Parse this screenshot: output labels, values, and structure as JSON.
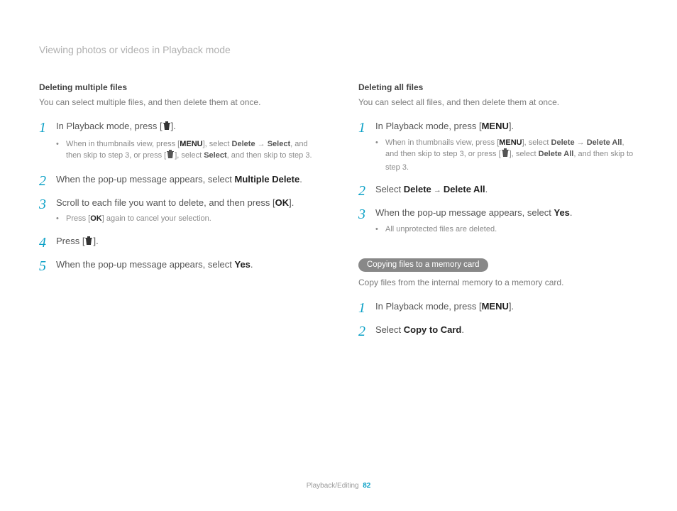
{
  "header": "Viewing photos or videos in Playback mode",
  "left": {
    "title": "Deleting multiple files",
    "intro": "You can select multiple files, and then delete them at once.",
    "s1": "In Playback mode, press [",
    "s1_end": "].",
    "s1_sub_a": "When in thumbnails view, press [",
    "s1_sub_b": "], select ",
    "s1_sub_delete": "Delete",
    "s1_sub_arrow": " → ",
    "s1_sub_select": "Select",
    "s1_sub_c": ", and then skip to step 3, or press [",
    "s1_sub_d": "], select ",
    "s1_sub_select2": "Select",
    "s1_sub_e": ", and then skip to step 3.",
    "s2_a": "When the pop-up message appears, select ",
    "s2_b": "Multiple Delete",
    "s2_c": ".",
    "s3_a": "Scroll to each file you want to delete, and then press [",
    "s3_b": "].",
    "s3_sub_a": "Press [",
    "s3_sub_b": "] again to cancel your selection.",
    "s4_a": "Press [",
    "s4_b": "].",
    "s5_a": "When the pop-up message appears, select ",
    "s5_b": "Yes",
    "s5_c": "."
  },
  "right": {
    "title": "Deleting all files",
    "intro": "You can select all files, and then delete them at once.",
    "s1": "In Playback mode, press [",
    "s1_end": "].",
    "s1_sub_a": "When in thumbnails view, press [",
    "s1_sub_b": "], select ",
    "s1_sub_delete": "Delete",
    "s1_sub_arrow": " → ",
    "s1_sub_deleteall": "Delete All",
    "s1_sub_c": ", and then skip to step 3, or press [",
    "s1_sub_d": "], select ",
    "s1_sub_deleteall2": "Delete All",
    "s1_sub_e": ", and then skip to step 3.",
    "s2_a": "Select ",
    "s2_b": "Delete",
    "s2_arrow": " → ",
    "s2_c": "Delete All",
    "s2_d": ".",
    "s3_a": "When the pop-up message appears, select ",
    "s3_b": "Yes",
    "s3_c": ".",
    "s3_sub": "All unprotected files are deleted.",
    "pill": "Copying files to a memory card",
    "copy_intro": "Copy files from the internal memory to a memory card.",
    "c1": "In Playback mode, press [",
    "c1_end": "].",
    "c2_a": "Select ",
    "c2_b": "Copy to Card",
    "c2_c": "."
  },
  "icons": {
    "menu": "MENU",
    "ok": "OK"
  },
  "footer": {
    "section": "Playback/Editing",
    "page": "82"
  }
}
